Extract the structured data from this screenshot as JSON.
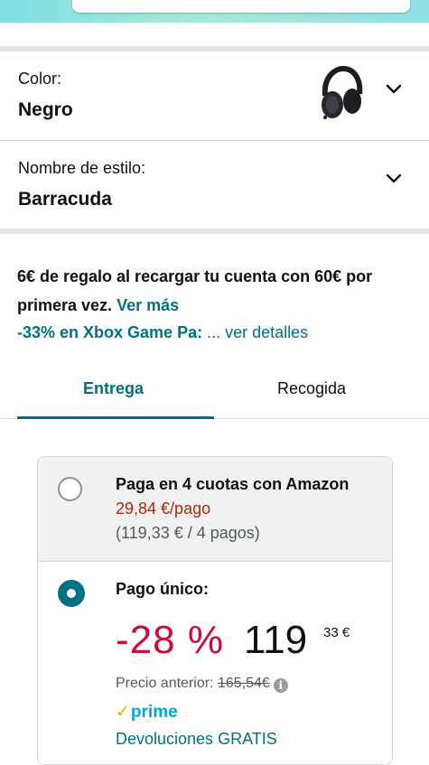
{
  "color_selector": {
    "label": "Color:",
    "value": "Negro"
  },
  "style_selector": {
    "label": "Nombre de estilo:",
    "value": "Barracuda"
  },
  "promo": {
    "text": "6€ de regalo al recargar tu cuenta con 60€ por primera vez.",
    "link": "Ver más",
    "xbox_bold": "-33% en Xbox Game Pa:",
    "xbox_link": "... ver detalles"
  },
  "tabs": [
    {
      "label": "Entrega"
    },
    {
      "label": "Recogida"
    }
  ],
  "payment": {
    "installments": {
      "title": "Paga en 4 cuotas con Amazon",
      "per_payment": "29,84 €/pago",
      "total": "(119,33 € / 4 pagos)"
    },
    "single": {
      "title": "Pago único:",
      "discount": "-28 %",
      "price_whole": "119",
      "price_fraction": "33 €",
      "previous_label": "Precio anterior:",
      "previous_price": "165,54€",
      "info_glyph": "i",
      "prime_check": "✓",
      "prime": "prime",
      "returns": "Devoluciones GRATIS"
    }
  },
  "colors": {
    "accent": "#007185",
    "price_red": "#b12704",
    "discount": "#cc0c39",
    "prime": "#00a8e1"
  }
}
